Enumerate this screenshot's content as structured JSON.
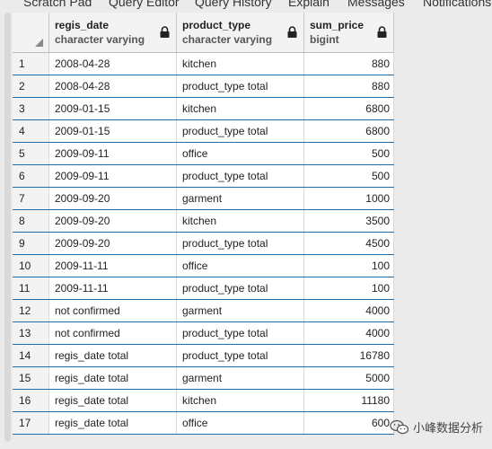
{
  "tabs": [
    "Scratch Pad",
    "Query Editor",
    "Query History",
    "Explain",
    "Messages",
    "Notifications"
  ],
  "columns": [
    {
      "name": "regis_date",
      "type": "character varying"
    },
    {
      "name": "product_type",
      "type": "character varying"
    },
    {
      "name": "sum_price",
      "type": "bigint"
    }
  ],
  "rows": [
    {
      "n": "1",
      "regis_date": "2008-04-28",
      "product_type": "kitchen",
      "sum_price": "880"
    },
    {
      "n": "2",
      "regis_date": "2008-04-28",
      "product_type": "product_type total",
      "sum_price": "880"
    },
    {
      "n": "3",
      "regis_date": "2009-01-15",
      "product_type": "kitchen",
      "sum_price": "6800"
    },
    {
      "n": "4",
      "regis_date": "2009-01-15",
      "product_type": "product_type total",
      "sum_price": "6800"
    },
    {
      "n": "5",
      "regis_date": "2009-09-11",
      "product_type": "office",
      "sum_price": "500"
    },
    {
      "n": "6",
      "regis_date": "2009-09-11",
      "product_type": "product_type total",
      "sum_price": "500"
    },
    {
      "n": "7",
      "regis_date": "2009-09-20",
      "product_type": "garment",
      "sum_price": "1000"
    },
    {
      "n": "8",
      "regis_date": "2009-09-20",
      "product_type": "kitchen",
      "sum_price": "3500"
    },
    {
      "n": "9",
      "regis_date": "2009-09-20",
      "product_type": "product_type total",
      "sum_price": "4500"
    },
    {
      "n": "10",
      "regis_date": "2009-11-11",
      "product_type": "office",
      "sum_price": "100"
    },
    {
      "n": "11",
      "regis_date": "2009-11-11",
      "product_type": "product_type total",
      "sum_price": "100"
    },
    {
      "n": "12",
      "regis_date": "not confirmed",
      "product_type": "garment",
      "sum_price": "4000"
    },
    {
      "n": "13",
      "regis_date": "not confirmed",
      "product_type": "product_type total",
      "sum_price": "4000"
    },
    {
      "n": "14",
      "regis_date": "regis_date total",
      "product_type": "product_type total",
      "sum_price": "16780"
    },
    {
      "n": "15",
      "regis_date": "regis_date total",
      "product_type": "garment",
      "sum_price": "5000"
    },
    {
      "n": "16",
      "regis_date": "regis_date total",
      "product_type": "kitchen",
      "sum_price": "11180"
    },
    {
      "n": "17",
      "regis_date": "regis_date total",
      "product_type": "office",
      "sum_price": "600"
    }
  ],
  "watermark": "小峰数据分析"
}
